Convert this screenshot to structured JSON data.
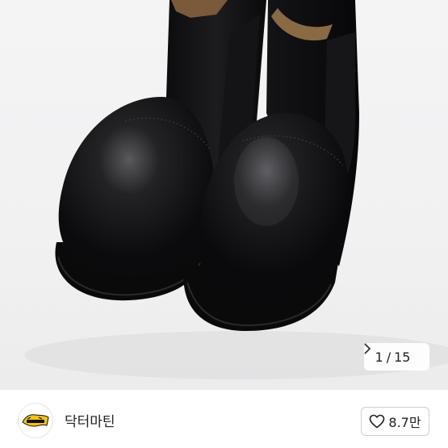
{
  "gallery": {
    "current": "1",
    "separator": "/",
    "total": "15",
    "next_icon": "chevron-right-icon"
  },
  "seller": {
    "name": "닥터마틴",
    "logo_icon": "dr-martens-logo",
    "logo_text": "Dr. Martens"
  },
  "like": {
    "icon": "heart-outline-icon",
    "count": "8.7만"
  },
  "colors": {
    "image_bg": "#f2f2f3",
    "boot_leather": "#0d0d0f",
    "logo_yellow": "#f2c21b",
    "text": "#222222"
  }
}
